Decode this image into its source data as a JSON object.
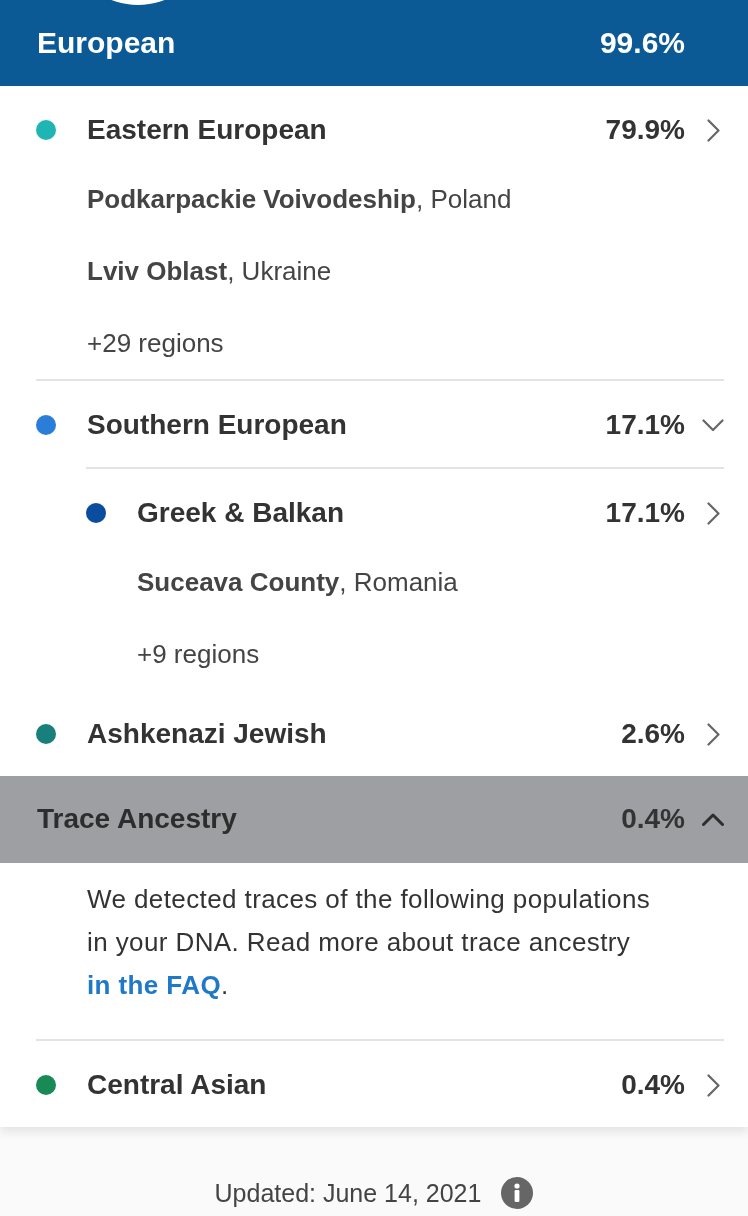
{
  "header": {
    "title": "European",
    "percent": "99.6%"
  },
  "populations": [
    {
      "name": "Eastern European",
      "percent": "79.9%",
      "color": "#1fb5b3",
      "expanded": false,
      "regions": [
        "**Podkarpackie Voivodeship**, Poland",
        "**Lviv Oblast**, Ukraine"
      ],
      "more": "+29 regions"
    },
    {
      "name": "Southern European",
      "percent": "17.1%",
      "color": "#2a7dd8",
      "expanded": true,
      "children": [
        {
          "name": "Greek & Balkan",
          "percent": "17.1%",
          "color": "#0a4da0",
          "regions": [
            "**Suceava County**, Romania"
          ],
          "more": "+9 regions"
        }
      ]
    },
    {
      "name": "Ashkenazi Jewish",
      "percent": "2.6%",
      "color": "#187f7b",
      "expanded": false
    }
  ],
  "trace": {
    "title": "Trace Ancestry",
    "percent": "0.4%",
    "expanded": true,
    "note": "We detected traces of the following populations in your DNA. Read more about trace ancestry",
    "link": "in the FAQ",
    "note_end": ".",
    "populations": [
      {
        "name": "Central Asian",
        "percent": "0.4%",
        "color": "#178a55"
      }
    ]
  },
  "footer": {
    "updated": "Updated: June 14, 2021"
  }
}
